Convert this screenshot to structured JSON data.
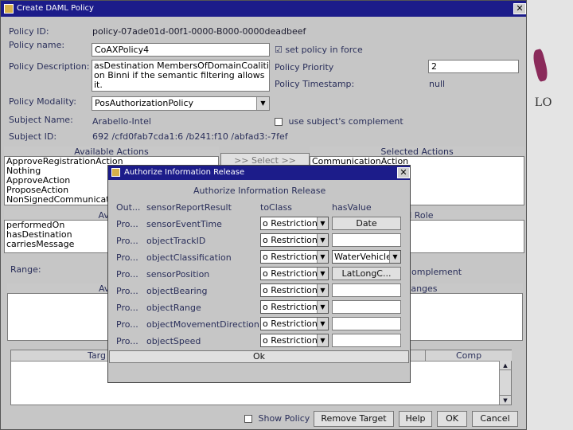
{
  "main_window": {
    "title": "Create DAML Policy",
    "close_glyph": "✕",
    "policy_id_label": "Policy ID:",
    "policy_id_value": "policy-07ade01d-00f1-0000-B000-0000deadbeef",
    "policy_name_label": "Policy name:",
    "policy_name_value": "CoAXPolicy4",
    "set_policy_label": "set policy in force",
    "set_policy_checked": "☑",
    "policy_description_label": "Policy Description:",
    "policy_description_lines": [
      "asDestination MembersOfDomainCoalitio",
      "on Binni if the semantic filtering allows",
      "it."
    ],
    "policy_priority_label": "Policy Priority",
    "policy_priority_value": "2",
    "policy_timestamp_label": "Policy Timestamp:",
    "policy_timestamp_value": "null",
    "policy_modality_label": "Policy Modality:",
    "policy_modality_value": "PosAuthorizationPolicy",
    "subject_name_label": "Subject Name:",
    "subject_name_value": "Arabello-Intel",
    "subject_complement_label": "use subject's complement",
    "subject_id_label": "Subject ID:",
    "subject_id_value": "692 /cfd0fab7cda1:6 /b241:f10 /abfad3:-7fef",
    "available_actions_header": "Available Actions",
    "available_actions": [
      "ApproveRegistrationAction",
      "Nothing",
      "ApproveAction",
      "ProposeAction",
      "NonSignedCommunicationAction"
    ],
    "select_button": ">> Select >>",
    "selected_actions_header": "Selected Actions",
    "selected_actions": [
      "CommunicationAction"
    ],
    "available_roles_header": "Availa",
    "available_roles": [
      "performedOn",
      "hasDestination",
      "carriesMessage"
    ],
    "selected_role_header": "ed Role",
    "range_label": "Range:",
    "range_complement_label": "omplement",
    "available_ranges_header": "Availab",
    "selected_ranges_header": "d Ranges",
    "target_header": "Targ",
    "comp_header": "Comp",
    "show_policy_label": "Show Policy",
    "remove_target_button": "Remove Target",
    "help_button": "Help",
    "ok_button": "OK",
    "cancel_button": "Cancel"
  },
  "dialog": {
    "title": "Authorize Information Release",
    "close_glyph": "✕",
    "heading": "Authorize Information Release",
    "col_out": "Out...",
    "col_sensor": "sensorReportResult",
    "col_toclass": "toClass",
    "col_hasvalue": "hasValue",
    "rows": [
      {
        "out": "Pro...",
        "prop": "sensorEventTime",
        "toclass": "o Restriction",
        "value": "Date",
        "value_kind": "button"
      },
      {
        "out": "Pro...",
        "prop": "objectTrackID",
        "toclass": "o Restriction",
        "value": "",
        "value_kind": "field"
      },
      {
        "out": "Pro...",
        "prop": "objectClassification",
        "toclass": "o Restriction",
        "value": "WaterVehicle",
        "value_kind": "combo"
      },
      {
        "out": "Pro...",
        "prop": "sensorPosition",
        "toclass": "o Restriction",
        "value": "LatLongC...",
        "value_kind": "button"
      },
      {
        "out": "Pro...",
        "prop": "objectBearing",
        "toclass": "o Restriction",
        "value": "",
        "value_kind": "field"
      },
      {
        "out": "Pro...",
        "prop": "objectRange",
        "toclass": "o Restriction",
        "value": "",
        "value_kind": "field"
      },
      {
        "out": "Pro...",
        "prop": "objectMovementDirection",
        "toclass": "o Restriction",
        "value": "",
        "value_kind": "field"
      },
      {
        "out": "Pro...",
        "prop": "objectSpeed",
        "toclass": "o Restriction",
        "value": "",
        "value_kind": "field"
      }
    ],
    "ok_button": "Ok",
    "dropdown_glyph": "▼"
  },
  "background": {
    "slide_text": "LO",
    "accent_color": "#8a2a5a"
  },
  "colors": {
    "titlebar": "#1c1c8a",
    "window_bg": "#c6c6c6",
    "label": "#2a2f5a"
  }
}
